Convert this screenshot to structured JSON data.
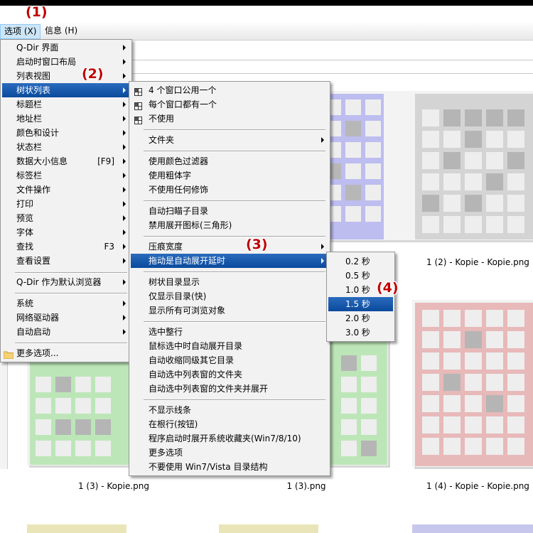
{
  "annotations": {
    "a1": "(1)",
    "a2": "(2)",
    "a3": "(3)",
    "a4": "(4)"
  },
  "menubar": {
    "options": "选项 (X)",
    "info": "信息 (H)"
  },
  "main_menu": {
    "items": [
      {
        "label": "Q-Dir 界面",
        "submenu": true
      },
      {
        "label": "启动时窗口布局",
        "submenu": true
      },
      {
        "label": "列表视图",
        "submenu": true
      },
      {
        "label": "树状列表",
        "submenu": true,
        "highlighted": true
      },
      {
        "label": "标题栏",
        "submenu": true
      },
      {
        "label": "地址栏",
        "submenu": true
      },
      {
        "label": "颜色和设计",
        "submenu": true
      },
      {
        "label": "状态栏",
        "submenu": true
      },
      {
        "label": "数据大小信息",
        "accel": "[F9]",
        "submenu": true
      },
      {
        "label": "标签栏",
        "submenu": true
      },
      {
        "label": "文件操作",
        "submenu": true
      },
      {
        "label": "打印",
        "submenu": true
      },
      {
        "label": "预览",
        "submenu": true
      },
      {
        "label": "字体",
        "submenu": true
      },
      {
        "label": "查找",
        "accel": "F3",
        "submenu": true
      },
      {
        "label": "查看设置",
        "submenu": true
      },
      {
        "label": "Q-Dir 作为默认浏览器",
        "submenu": true
      },
      {
        "label": "系统",
        "submenu": true
      },
      {
        "label": "网络驱动器",
        "submenu": true
      },
      {
        "label": "自动启动",
        "submenu": true
      },
      {
        "label": "更多选项...",
        "icon": "folder-icon"
      }
    ]
  },
  "tree_menu": {
    "items": [
      {
        "label": "4 个窗口公用一个",
        "icon": "grid-icon"
      },
      {
        "label": "每个窗口都有一个",
        "icon": "grid-icon"
      },
      {
        "label": "不使用",
        "icon": "grid-icon"
      },
      {
        "label": "文件夹",
        "submenu": true
      },
      {
        "label": "使用颜色过滤器"
      },
      {
        "label": "使用粗体字"
      },
      {
        "label": "不使用任何修饰"
      },
      {
        "label": "自动扫瞄子目录"
      },
      {
        "label": "禁用展开图标(三角形)"
      },
      {
        "label": "压痕宽度",
        "submenu": true
      },
      {
        "label": "拖动是自动展开延时",
        "submenu": true,
        "highlighted": true
      },
      {
        "label": "树状目录显示"
      },
      {
        "label": "仅显示目录(快)"
      },
      {
        "label": "显示所有可浏览对象"
      },
      {
        "label": "选中整行"
      },
      {
        "label": "鼠标选中时自动展开目录"
      },
      {
        "label": "自动收缩同级其它目录"
      },
      {
        "label": "自动选中列表窗的文件夹"
      },
      {
        "label": "自动选中列表窗的文件夹并展开"
      },
      {
        "label": "不显示线条"
      },
      {
        "label": "在根行(按钮)"
      },
      {
        "label": "程序启动时展开系统收藏夹(Win7/8/10)"
      },
      {
        "label": "更多选项"
      },
      {
        "label": "不要使用 Win7/Vista 目录结构"
      }
    ]
  },
  "delay_menu": {
    "items": [
      {
        "label": "0.2 秒"
      },
      {
        "label": "0.5 秒"
      },
      {
        "label": "1.0 秒"
      },
      {
        "label": "1.5 秒",
        "highlighted": true
      },
      {
        "label": "2.0 秒"
      },
      {
        "label": "3.0 秒"
      }
    ]
  },
  "captions": {
    "c1": "1 (2) - Kopie - Kopie.png",
    "c2": "1 (3) - Kopie.png",
    "c3": "1 (3).png",
    "c4": "1 (4) - Kopie - Kopie.png"
  },
  "colors": {
    "menu_bg": "#f2f2f2",
    "highlight": "#0a4a9d",
    "annotation": "#c00000"
  }
}
